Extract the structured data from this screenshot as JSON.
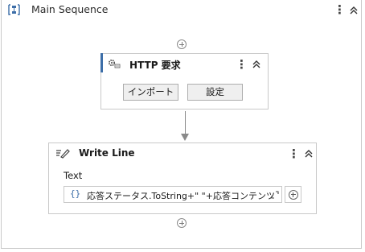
{
  "sequence": {
    "title": "Main Sequence"
  },
  "http_activity": {
    "title": "HTTP 要求",
    "import_button": "インポート",
    "settings_button": "設定"
  },
  "write_line": {
    "title": "Write Line",
    "field_label": "Text",
    "field_value": "応答ステータス.ToString+\" \"+応答コンテンツ"
  },
  "colors": {
    "accent": "#3d6ea8",
    "border": "#c9c9c9"
  }
}
